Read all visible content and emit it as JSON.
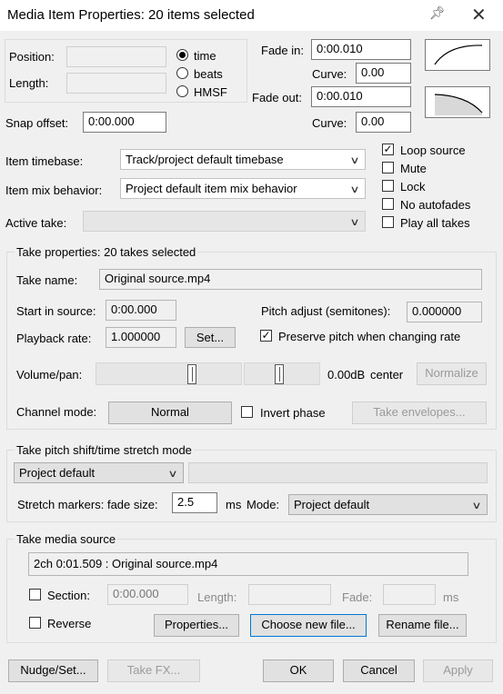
{
  "window": {
    "title": "Media Item Properties:  20 items selected"
  },
  "position": {
    "position_label": "Position:",
    "length_label": "Length:",
    "position_value": "",
    "length_value": ""
  },
  "timebase_radio": {
    "time": "time",
    "beats": "beats",
    "hmsf": "HMSF"
  },
  "fade": {
    "in_label": "Fade in:",
    "in_value": "0:00.010",
    "curve_label": "Curve:",
    "in_curve": "0.00",
    "out_label": "Fade out:",
    "out_value": "0:00.010",
    "out_curve": "0.00"
  },
  "snap": {
    "label": "Snap offset:",
    "value": "0:00.000"
  },
  "item": {
    "timebase_label": "Item timebase:",
    "timebase_value": "Track/project default timebase",
    "mix_label": "Item mix behavior:",
    "mix_value": "Project default item mix behavior",
    "active_take_label": "Active take:",
    "active_take_value": ""
  },
  "checkboxes": {
    "loop": "Loop source",
    "mute": "Mute",
    "lock": "Lock",
    "no_autofades": "No autofades",
    "play_all_takes": "Play all takes",
    "loop_checked": true
  },
  "take": {
    "group_title": "Take properties:  20 takes selected",
    "name_label": "Take name:",
    "name_value": "Original source.mp4",
    "start_label": "Start in source:",
    "start_value": "0:00.000",
    "pitch_label": "Pitch adjust (semitones):",
    "pitch_value": "0.000000",
    "rate_label": "Playback rate:",
    "rate_value": "1.000000",
    "set_button": "Set...",
    "preserve_pitch": "Preserve pitch when changing rate",
    "preserve_checked": true,
    "volpan_label": "Volume/pan:",
    "vol_readout": "0.00dB",
    "pan_readout": "center",
    "normalize_button": "Normalize",
    "channel_label": "Channel mode:",
    "channel_value": "Normal",
    "invert_phase": "Invert phase",
    "envelopes_button": "Take envelopes..."
  },
  "pitch_shift": {
    "group_title": "Take pitch shift/time stretch mode",
    "mode_value": "Project default",
    "submode_value": "",
    "fade_label": "Stretch markers: fade size:",
    "fade_value": "2.5",
    "ms_label": "ms",
    "mode_label": "Mode:",
    "stretch_mode_value": "Project default"
  },
  "media_source": {
    "group_title": "Take media source",
    "source_value": "2ch 0:01.509 : Original source.mp4",
    "section_label": "Section:",
    "section_value": "0:00.000",
    "length_label": "Length:",
    "length_value": "",
    "fade_label": "Fade:",
    "fade_value": "",
    "ms_label": "ms",
    "reverse_label": "Reverse",
    "properties_button": "Properties...",
    "choose_button": "Choose new file...",
    "rename_button": "Rename file..."
  },
  "footer": {
    "nudge_button": "Nudge/Set...",
    "takefx_button": "Take FX...",
    "ok_button": "OK",
    "cancel_button": "Cancel",
    "apply_button": "Apply"
  }
}
